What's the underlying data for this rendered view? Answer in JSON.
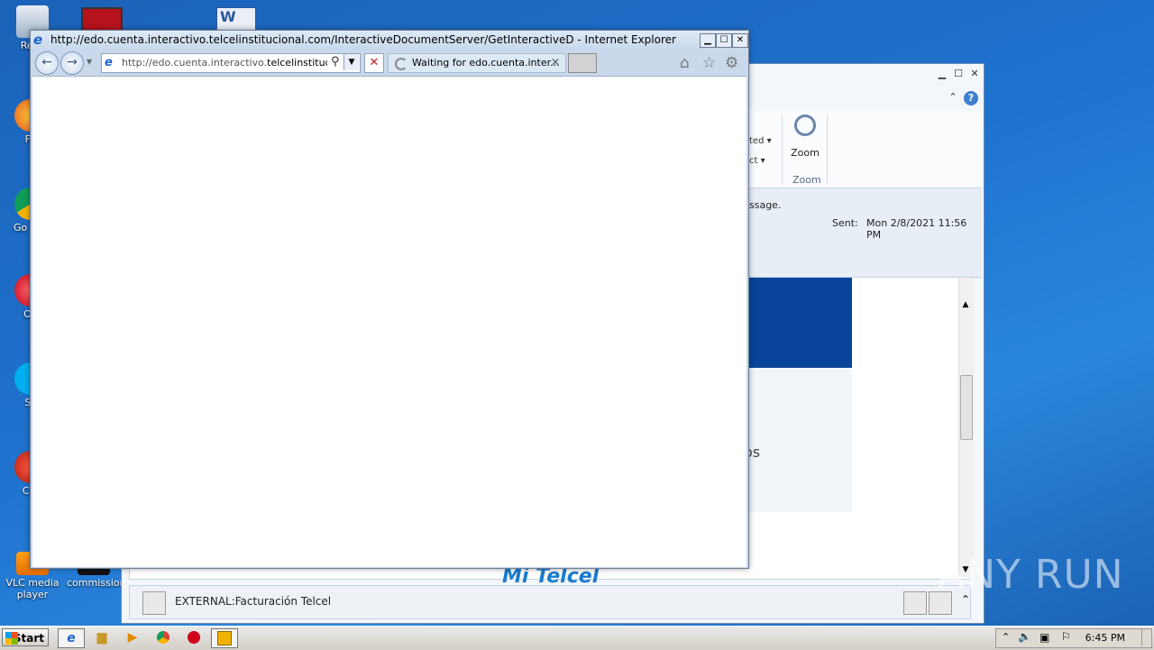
{
  "desktop": {
    "icons": [
      {
        "label": "Recy"
      },
      {
        "label": "Fir"
      },
      {
        "label": "Go Chr"
      },
      {
        "label": "Op"
      },
      {
        "label": "Sk"
      },
      {
        "label": "CCl"
      },
      {
        "label": "VLC media player"
      },
      {
        "label": "commission"
      }
    ]
  },
  "ie": {
    "title": "http://edo.cuenta.interactivo.telcelinstitucional.com/InteractiveDocumentServer/GetInteractiveD - Internet Explorer",
    "address_prefix": "http://edo.cuenta.interactivo.",
    "address_domain": "telcelinstitucio...",
    "tab_label": "Waiting for edo.cuenta.inter...",
    "min_label": "▁",
    "max_label": "☐",
    "close_label": "✕",
    "back_glyph": "←",
    "forward_glyph": "→",
    "stop_glyph": "✕",
    "home_glyph": "⌂",
    "fav_glyph": "☆",
    "tools_glyph": "⚙"
  },
  "outlook": {
    "ribbon_partial_1": "ted ▾",
    "ribbon_partial_2": "ct ▾",
    "zoom_button": "Zoom",
    "zoom_group": "Zoom",
    "message_partial": "ssage.",
    "sent_label": "Sent:",
    "sent_value": "Mon 2/8/2021 11:56 PM",
    "body_partial": "os",
    "mi_telcel": "Mi Telcel",
    "people_pane_name": "EXTERNAL:Facturación Telcel"
  },
  "taskbar": {
    "start_label": "Start",
    "clock": "6:45 PM"
  },
  "watermark": "ANY RUN"
}
